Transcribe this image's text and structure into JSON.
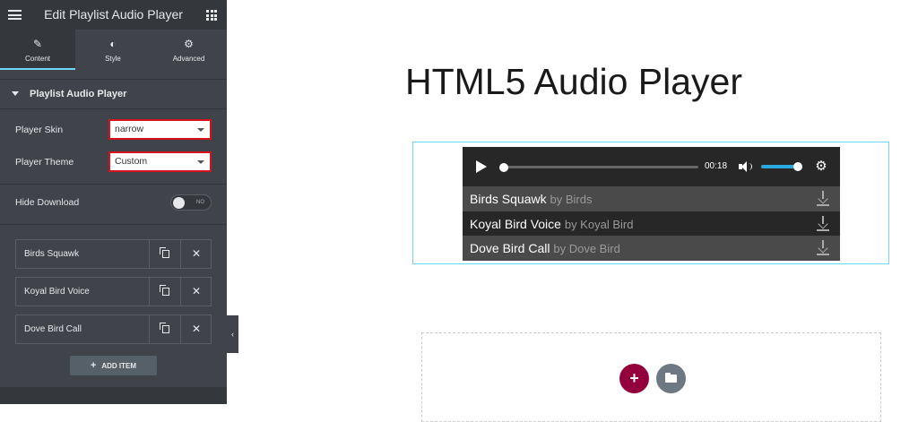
{
  "editor": {
    "title": "Edit Playlist Audio Player",
    "tabs": [
      {
        "label": "Content",
        "icon": "pencil-icon"
      },
      {
        "label": "Style",
        "icon": "half-circle-icon"
      },
      {
        "label": "Advanced",
        "icon": "gear-icon"
      }
    ],
    "section_title": "Playlist Audio Player",
    "player_skin_label": "Player Skin",
    "player_skin_value": "narrow",
    "player_theme_label": "Player Theme",
    "player_theme_value": "Custom",
    "hide_download_label": "Hide Download",
    "hide_download_toggle": "NO",
    "items": [
      {
        "label": "Birds Squawk"
      },
      {
        "label": "Koyal Bird Voice"
      },
      {
        "label": "Dove Bird Call"
      }
    ],
    "add_item_label": "ADD ITEM",
    "highlight_color": "#d6131c",
    "accent_color": "#71d7f7"
  },
  "canvas": {
    "heading": "HTML5 Audio Player",
    "player": {
      "current_time": "00:18",
      "progress": 0.0,
      "volume": 0.9,
      "tracks": [
        {
          "title": "Birds Squawk",
          "artist": "by Birds"
        },
        {
          "title": "Koyal Bird Voice",
          "artist": "by Koyal Bird"
        },
        {
          "title": "Dove Bird Call",
          "artist": "by Dove Bird"
        }
      ]
    },
    "add_section_color": "#93003c"
  }
}
